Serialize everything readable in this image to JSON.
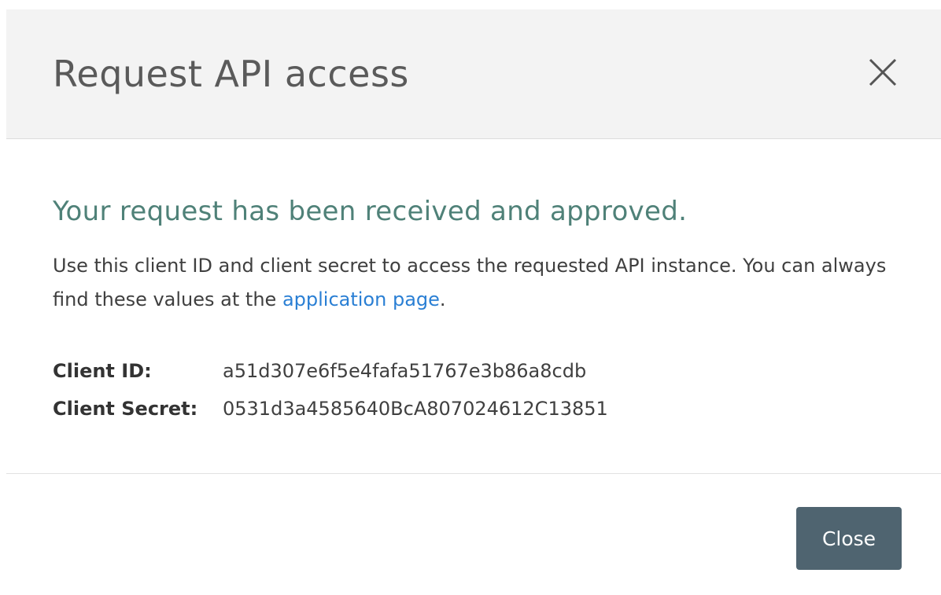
{
  "modal": {
    "title": "Request API access",
    "close_icon": "close-icon"
  },
  "body": {
    "success_heading": "Your request has been received and approved.",
    "description_before": "Use this client ID and client secret to access the requested API instance. You can always find these values at the",
    "link_text": "application page",
    "description_after": ".",
    "credentials": {
      "client_id_label": "Client ID:",
      "client_id_value": "a51d307e6f5e4fafa51767e3b86a8cdb",
      "client_secret_label": "Client Secret:",
      "client_secret_value": "0531d3a4585640BcA807024612C13851"
    }
  },
  "footer": {
    "close_label": "Close"
  },
  "colors": {
    "header_bg": "#f3f3f3",
    "success_text": "#4f8178",
    "link": "#2a7fd4",
    "button_bg": "#4f6470"
  }
}
